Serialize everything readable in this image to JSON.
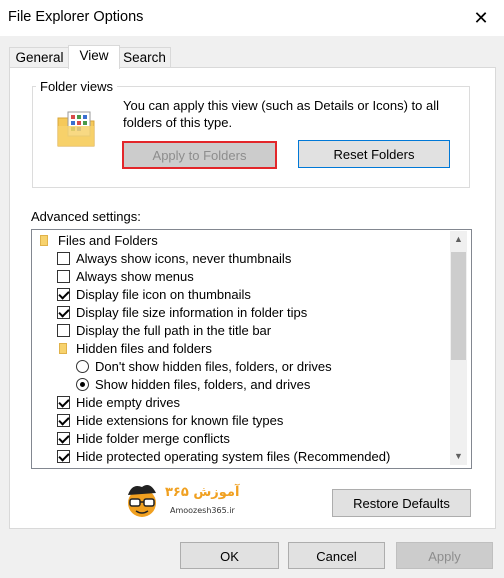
{
  "window": {
    "title": "File Explorer Options",
    "close_glyph": "✕"
  },
  "tabs": [
    {
      "label": "General"
    },
    {
      "label": "View",
      "active": true
    },
    {
      "label": "Search"
    }
  ],
  "folder_views": {
    "label": "Folder views",
    "description": "You can apply this view (such as Details or Icons) to all folders of this type.",
    "apply_button": "Apply to Folders",
    "reset_button": "Reset Folders",
    "icon": "folder-views-icon"
  },
  "advanced": {
    "label": "Advanced settings:",
    "items": [
      {
        "type": "folder",
        "label": "Files and Folders"
      },
      {
        "type": "checkbox",
        "checked": false,
        "label": "Always show icons, never thumbnails"
      },
      {
        "type": "checkbox",
        "checked": false,
        "label": "Always show menus"
      },
      {
        "type": "checkbox",
        "checked": true,
        "label": "Display file icon on thumbnails"
      },
      {
        "type": "checkbox",
        "checked": true,
        "label": "Display file size information in folder tips"
      },
      {
        "type": "checkbox",
        "checked": false,
        "label": "Display the full path in the title bar"
      },
      {
        "type": "folder",
        "label": "Hidden files and folders"
      },
      {
        "type": "radio",
        "checked": false,
        "label": "Don't show hidden files, folders, or drives"
      },
      {
        "type": "radio",
        "checked": true,
        "label": "Show hidden files, folders, and drives"
      },
      {
        "type": "checkbox",
        "checked": true,
        "label": "Hide empty drives"
      },
      {
        "type": "checkbox",
        "checked": true,
        "label": "Hide extensions for known file types"
      },
      {
        "type": "checkbox",
        "checked": true,
        "label": "Hide folder merge conflicts"
      },
      {
        "type": "checkbox",
        "checked": true,
        "label": "Hide protected operating system files (Recommended)"
      }
    ],
    "scroll_up_glyph": "▲",
    "scroll_down_glyph": "▼"
  },
  "logo": {
    "text": "آموزش ۳۶۵",
    "sub": "Amoozesh365.ir"
  },
  "buttons": {
    "restore_defaults": "Restore Defaults",
    "ok": "OK",
    "cancel": "Cancel",
    "apply": "Apply"
  },
  "colors": {
    "highlight_border": "#e3262a",
    "focus_border": "#0078d7"
  }
}
